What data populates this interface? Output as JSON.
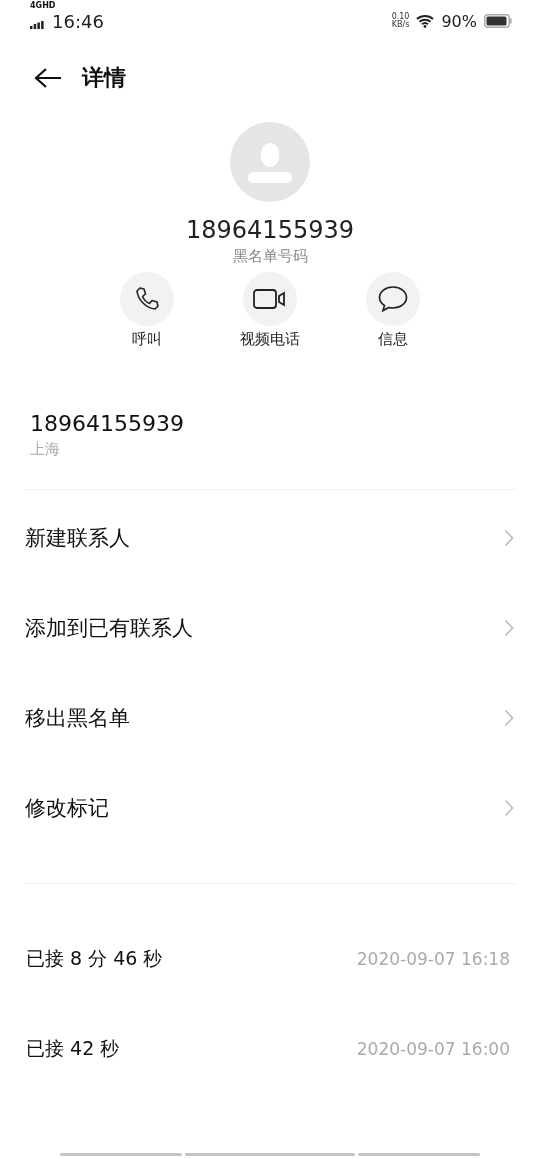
{
  "status_bar": {
    "network": "4GHD",
    "time": "16:46",
    "speed": "0.10",
    "speed_unit": "KB/s",
    "battery": "90%"
  },
  "header": {
    "title": "详情"
  },
  "contact": {
    "number": "18964155939",
    "label": "黑名单号码"
  },
  "actions": [
    {
      "kind": "call",
      "label": "呼叫"
    },
    {
      "kind": "video",
      "label": "视频电话"
    },
    {
      "kind": "message",
      "label": "信息"
    }
  ],
  "phone": {
    "number": "18964155939",
    "location": "上海"
  },
  "menu": [
    "新建联系人",
    "添加到已有联系人",
    "移出黑名单",
    "修改标记"
  ],
  "call_log": [
    {
      "status": "已接 8 分 46 秒",
      "time": "2020-09-07 16:18"
    },
    {
      "status": "已接 42 秒",
      "time": "2020-09-07 16:00"
    }
  ]
}
